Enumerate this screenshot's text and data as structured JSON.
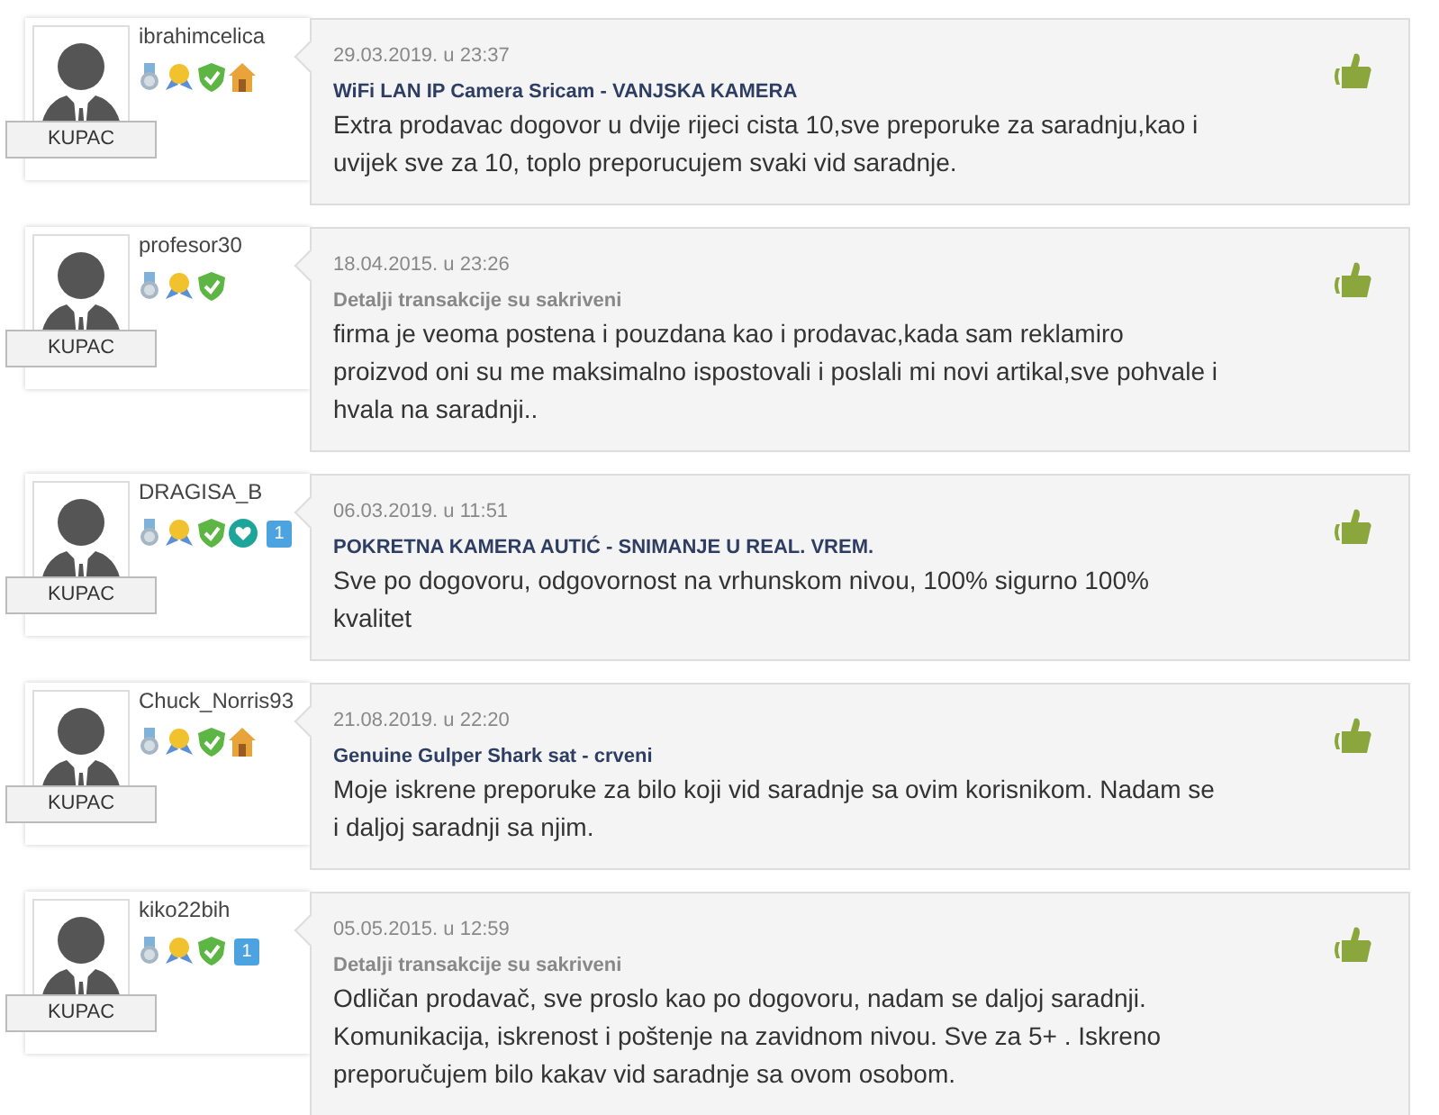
{
  "reviews": [
    {
      "user": "ibrahimcelica",
      "role": "KUPAC",
      "badges": [
        {
          "kind": "medal"
        },
        {
          "kind": "award"
        },
        {
          "kind": "shield"
        },
        {
          "kind": "house"
        }
      ],
      "date": "29.03.2019. u 23:37",
      "subject": {
        "kind": "product",
        "text": "WiFi LAN IP Camera Sricam - VANJSKA KAMERA"
      },
      "text": "Extra prodavac dogovor u dvije rijeci cista 10,sve preporuke za saradnju,kao i uvijek sve za 10, toplo preporucujem svaki vid saradnje.",
      "positive": true
    },
    {
      "user": "profesor30",
      "role": "KUPAC",
      "badges": [
        {
          "kind": "medal"
        },
        {
          "kind": "award"
        },
        {
          "kind": "shield"
        }
      ],
      "date": "18.04.2015. u 23:26",
      "subject": {
        "kind": "hidden",
        "text": "Detalji transakcije su sakriveni"
      },
      "text": "firma je veoma postena i pouzdana kao i prodavac,kada sam reklamiro proizvod oni su me maksimalno ispostovali i poslali mi novi artikal,sve pohvale i hvala na saradnji..",
      "positive": true
    },
    {
      "user": "DRAGISA_B",
      "role": "KUPAC",
      "badges": [
        {
          "kind": "medal"
        },
        {
          "kind": "award"
        },
        {
          "kind": "shield"
        },
        {
          "kind": "heart"
        },
        {
          "kind": "count",
          "text": "1"
        }
      ],
      "date": "06.03.2019. u 11:51",
      "subject": {
        "kind": "product",
        "text": "POKRETNA KAMERA AUTIĆ - SNIMANJE U REAL. VREM."
      },
      "text": "Sve po dogovoru, odgovornost na vrhunskom nivou, 100% sigurno 100% kvalitet",
      "positive": true
    },
    {
      "user": "Chuck_Norris93",
      "role": "KUPAC",
      "badges": [
        {
          "kind": "medal"
        },
        {
          "kind": "award"
        },
        {
          "kind": "shield"
        },
        {
          "kind": "house"
        }
      ],
      "date": "21.08.2019. u 22:20",
      "subject": {
        "kind": "product",
        "text": "Genuine Gulper Shark sat - crveni"
      },
      "text": "Moje iskrene preporuke za bilo koji vid saradnje sa ovim korisnikom. Nadam se i daljoj saradnji sa njim.",
      "positive": true
    },
    {
      "user": "kiko22bih",
      "role": "KUPAC",
      "badges": [
        {
          "kind": "medal"
        },
        {
          "kind": "award"
        },
        {
          "kind": "shield"
        },
        {
          "kind": "count",
          "text": "1"
        }
      ],
      "date": "05.05.2015. u 12:59",
      "subject": {
        "kind": "hidden",
        "text": "Detalji transakcije su sakriveni"
      },
      "text": "Odličan prodavač, sve proslo kao po dogovoru, nadam se daljoj saradnji. Komunikacija, iskrenost i poštenje na zavidnom nivou. Sve za 5+ . Iskreno preporučujem bilo kakav vid saradnje sa ovom osobom.",
      "positive": true
    }
  ]
}
